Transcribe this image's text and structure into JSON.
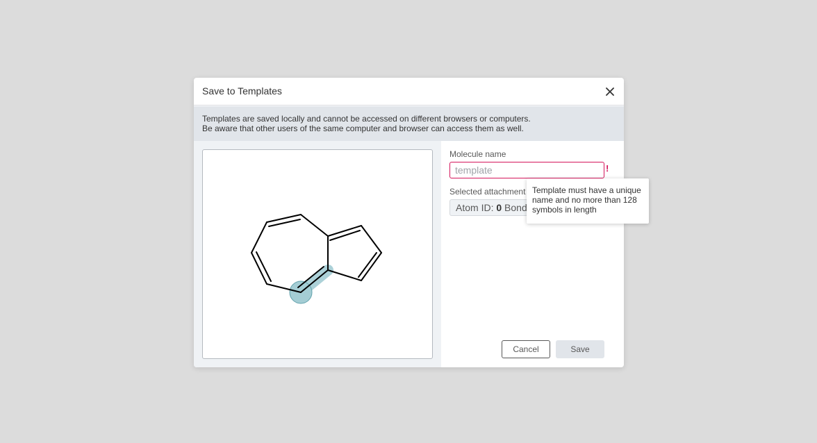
{
  "dialog": {
    "title": "Save to Templates",
    "close_icon": "close-icon",
    "info_line1": "Templates are saved locally and cannot be accessed on different browsers or computers.",
    "info_line2": "Be aware that other users of the same computer and browser can access them as well."
  },
  "form": {
    "molecule_name_label": "Molecule name",
    "molecule_name_value": "",
    "molecule_name_placeholder": "template",
    "error_mark": "!",
    "attachment_label": "Selected attachment p",
    "atom_id_label": "Atom ID:",
    "atom_id_value": "0",
    "bond_label": "Bond"
  },
  "tooltip": {
    "text": "Template must have a unique name and no more than 128 symbols in length"
  },
  "buttons": {
    "cancel_label": "Cancel",
    "save_label": "Save"
  },
  "colors": {
    "accent_error": "#d4145a",
    "highlight": "#a4cdd4",
    "highlight_stroke": "#62a2ac",
    "info_bg": "#e1e5ea"
  }
}
